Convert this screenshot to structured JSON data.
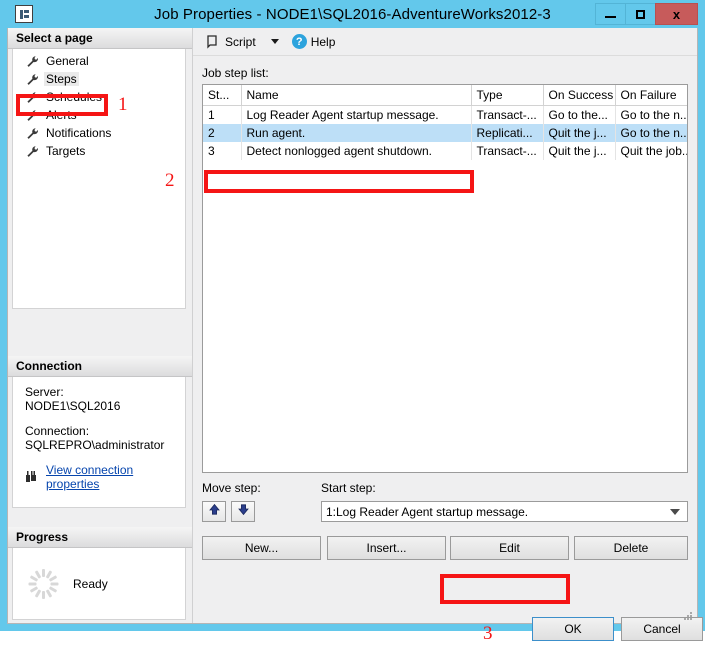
{
  "window": {
    "title": "Job Properties - NODE1\\SQL2016-AdventureWorks2012-3",
    "app_icon": "sql-job-icon",
    "minimize_label": "–",
    "maximize_label": "□",
    "close_label": "x"
  },
  "sidebar": {
    "header": "Select a page",
    "items": [
      {
        "label": "General",
        "icon": "wrench-icon",
        "selected": false
      },
      {
        "label": "Steps",
        "icon": "wrench-icon",
        "selected": true
      },
      {
        "label": "Schedules",
        "icon": "wrench-icon",
        "selected": false
      },
      {
        "label": "Alerts",
        "icon": "wrench-icon",
        "selected": false
      },
      {
        "label": "Notifications",
        "icon": "wrench-icon",
        "selected": false
      },
      {
        "label": "Targets",
        "icon": "wrench-icon",
        "selected": false
      }
    ],
    "connection": {
      "header": "Connection",
      "server_label": "Server:",
      "server_value": "NODE1\\SQL2016",
      "connection_label": "Connection:",
      "connection_value": "SQLREPRO\\administrator",
      "view_link": "View connection properties",
      "view_link_icon": "connection-properties-icon"
    },
    "progress": {
      "header": "Progress",
      "status": "Ready",
      "spinner_icon": "loading-spinner-icon"
    }
  },
  "toolbar": {
    "script_label": "Script",
    "script_icon": "script-icon",
    "dropdown_icon": "chevron-down-icon",
    "help_label": "Help",
    "help_icon": "help-question-icon"
  },
  "main": {
    "list_label": "Job step list:",
    "columns": [
      "St...",
      "Name",
      "Type",
      "On Success",
      "On Failure"
    ],
    "rows": [
      {
        "step": "1",
        "name": "Log Reader Agent startup message.",
        "type": "Transact-...",
        "on_success": "Go to the...",
        "on_failure": "Go to the n...",
        "selected": false
      },
      {
        "step": "2",
        "name": "Run agent.",
        "type": "Replicati...",
        "on_success": "Quit the j...",
        "on_failure": "Go to the n...",
        "selected": true
      },
      {
        "step": "3",
        "name": "Detect nonlogged agent shutdown.",
        "type": "Transact-...",
        "on_success": "Quit the j...",
        "on_failure": "Quit the job...",
        "selected": false
      }
    ],
    "move_step_label": "Move step:",
    "move_up_icon": "arrow-up-icon",
    "move_down_icon": "arrow-down-icon",
    "start_step_label": "Start step:",
    "start_step_value": "1:Log Reader Agent startup message.",
    "start_step_caret_icon": "chevron-down-icon",
    "buttons": {
      "new": "New...",
      "insert": "Insert...",
      "edit": "Edit",
      "delete": "Delete"
    }
  },
  "footer": {
    "ok": "OK",
    "cancel": "Cancel",
    "resize_grip_icon": "resize-grip-icon"
  },
  "annotations": {
    "one": "1",
    "two": "2",
    "three": "3",
    "color": "#f51515"
  }
}
